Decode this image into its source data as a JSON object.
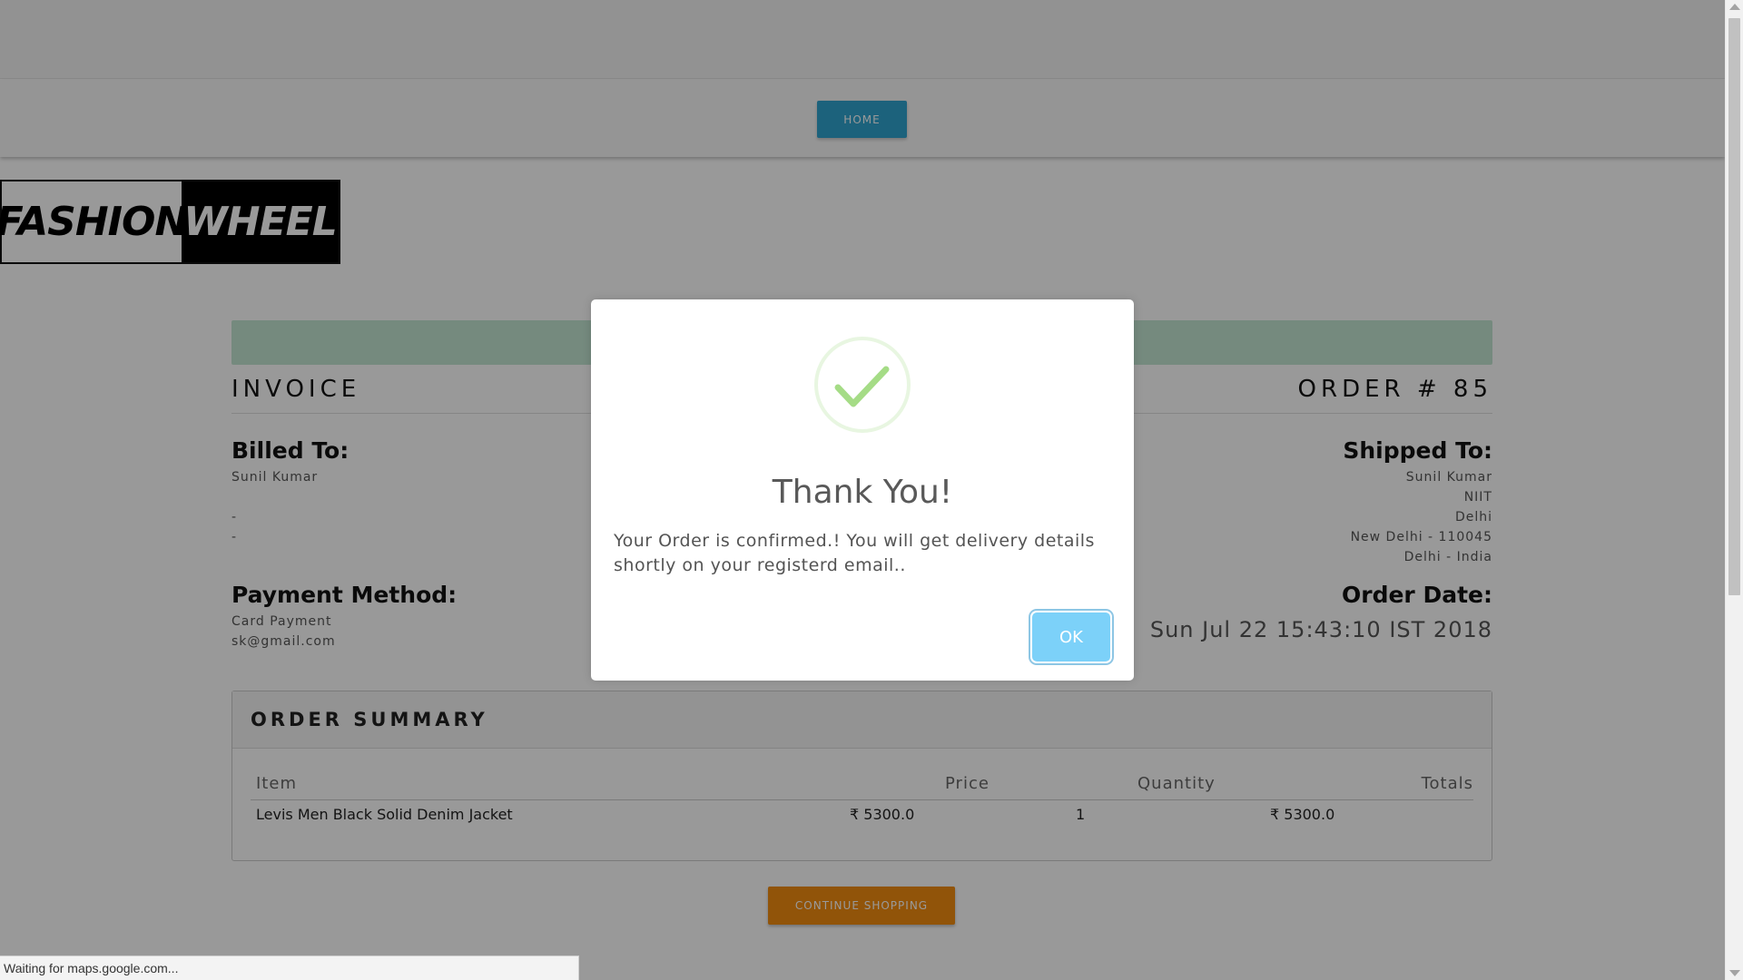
{
  "nav": {
    "home_label": "HOME"
  },
  "logo": {
    "left_text": "FASHION",
    "right_text": "WHEEL"
  },
  "invoice": {
    "title": "INVOICE",
    "order_number": "ORDER # 85",
    "billed_to": {
      "label": "Billed To:",
      "name": "Sunil Kumar",
      "line2": "-",
      "line3": "-"
    },
    "shipped_to": {
      "label": "Shipped To:",
      "name": "Sunil Kumar",
      "line2": "NIIT",
      "line3": "Delhi",
      "line4": "New Delhi - 110045",
      "line5": "Delhi - India"
    },
    "payment": {
      "label": "Payment Method:",
      "method": "Card Payment",
      "email": "sk@gmail.com"
    },
    "order_date": {
      "label": "Order Date:",
      "value": "Sun Jul 22 15:43:10 IST 2018"
    }
  },
  "summary": {
    "title": "ORDER SUMMARY",
    "headers": {
      "item": "Item",
      "price": "Price",
      "quantity": "Quantity",
      "totals": "Totals"
    },
    "rows": [
      {
        "item": "Levis Men Black Solid Denim Jacket",
        "price": "₹ 5300.0",
        "quantity": "1",
        "total": "₹ 5300.0"
      }
    ]
  },
  "continue_label": "CONTINUE SHOPPING",
  "modal": {
    "title": "Thank You!",
    "message": "Your Order is confirmed.! You will get delivery details shortly on your registerd email..",
    "ok_label": "OK",
    "success_color": "#a5dc86"
  },
  "status_bar": {
    "text": "Waiting for maps.google.com..."
  }
}
